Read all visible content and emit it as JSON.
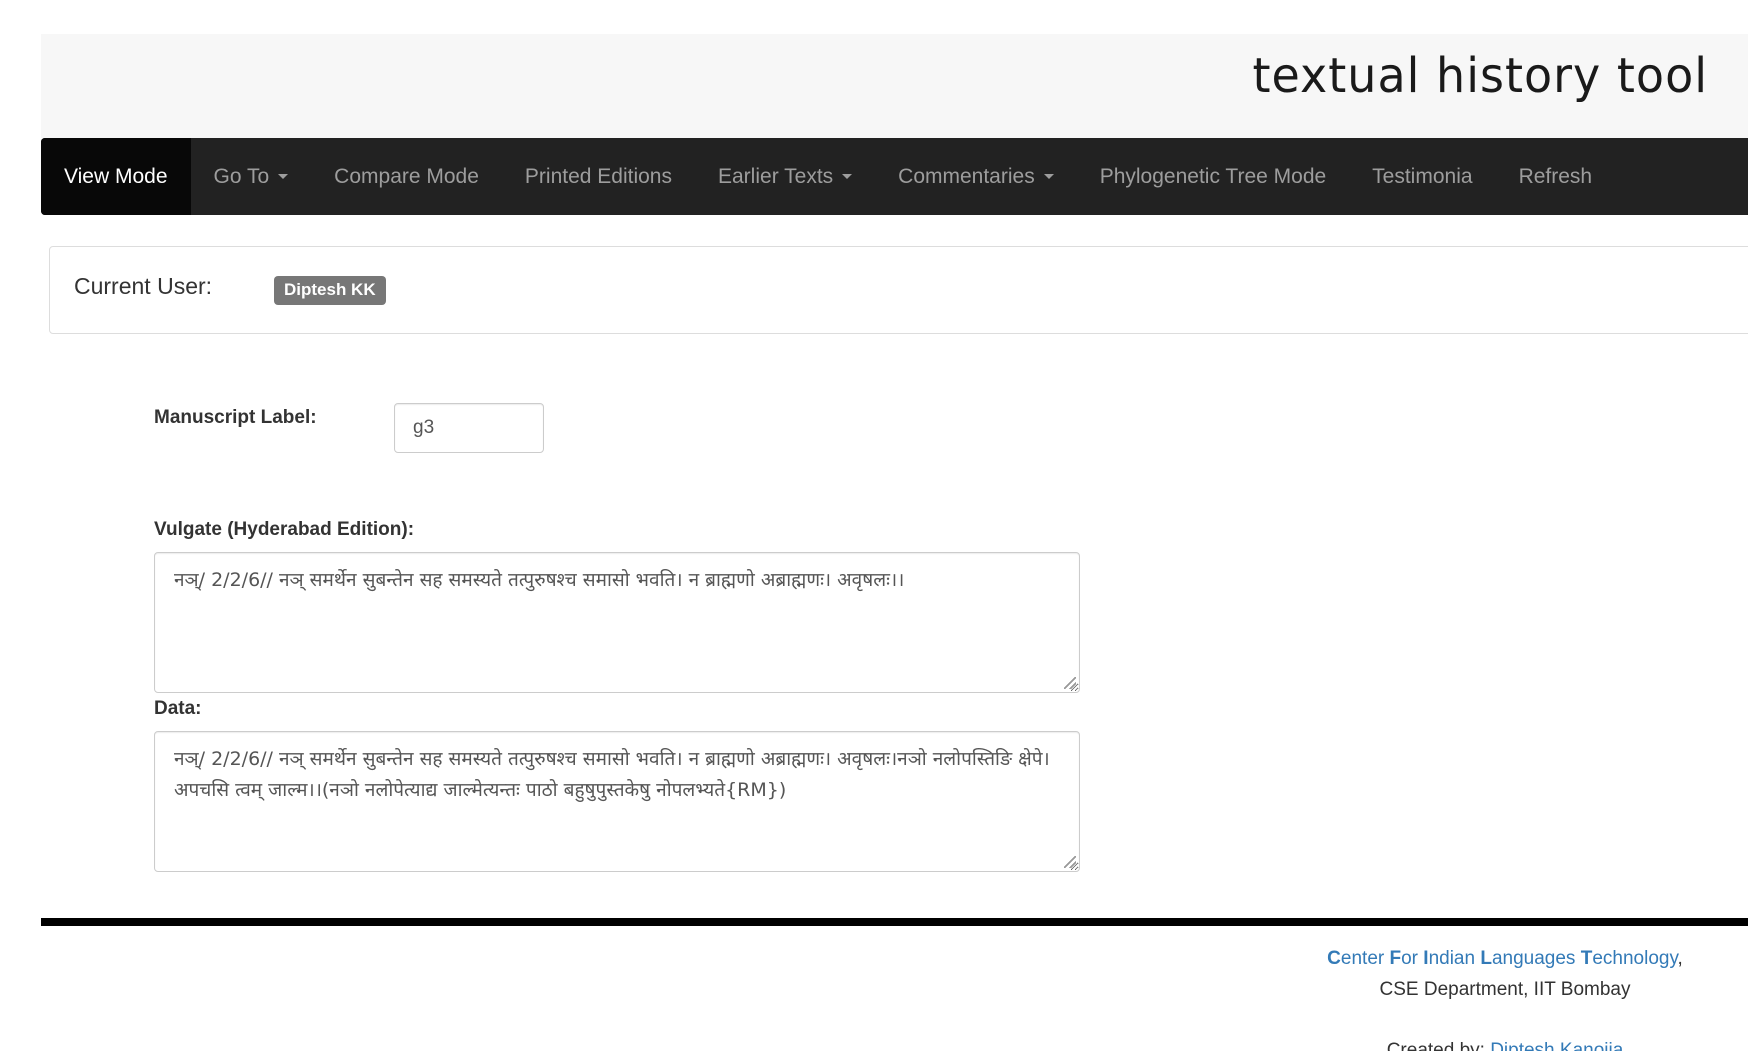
{
  "header": {
    "title": "textual history tool"
  },
  "navbar": {
    "items": [
      {
        "label": "View Mode",
        "active": true,
        "dropdown": false
      },
      {
        "label": "Go To",
        "active": false,
        "dropdown": true
      },
      {
        "label": "Compare Mode",
        "active": false,
        "dropdown": false
      },
      {
        "label": "Printed Editions",
        "active": false,
        "dropdown": false
      },
      {
        "label": "Earlier Texts",
        "active": false,
        "dropdown": true
      },
      {
        "label": "Commentaries",
        "active": false,
        "dropdown": true
      },
      {
        "label": "Phylogenetic Tree Mode",
        "active": false,
        "dropdown": false
      },
      {
        "label": "Testimonia",
        "active": false,
        "dropdown": false
      },
      {
        "label": "Refresh",
        "active": false,
        "dropdown": false
      }
    ]
  },
  "user_panel": {
    "label": "Current User:",
    "user": "Diptesh KK"
  },
  "form": {
    "manuscript_label": "Manuscript Label:",
    "manuscript_value": "g3",
    "vulgate_label": "Vulgate (Hyderabad Edition):",
    "vulgate_text": "नञ्/ 2/2/6// नञ् समर्थेन सुबन्तेन सह समस्यते तत्पुरुषश्च समासो भवति। न ब्राह्मणो अब्राह्मणः। अवृषलः।।",
    "data_label": "Data:",
    "data_text": "नञ्/ 2/2/6// नञ् समर्थेन सुबन्तेन सह समस्यते तत्पुरुषश्च समासो भवति। न ब्राह्मणो अब्राह्मणः। अवृषलः।नञो नलोपस्तिङि क्षेपे। अपचसि त्वम् जाल्म।।(नञो नलोपेत्याद्य जाल्मेत्यन्तः पाठो बहुषुपुस्तकेषु नोपलभ्यते{RM})"
  },
  "footer": {
    "org_parts": [
      {
        "initial": "C",
        "rest": "enter "
      },
      {
        "initial": "F",
        "rest": "or "
      },
      {
        "initial": "I",
        "rest": "ndian "
      },
      {
        "initial": "L",
        "rest": "anguages "
      },
      {
        "initial": "T",
        "rest": "echnology"
      }
    ],
    "org_suffix": ",",
    "department": "CSE Department, IIT Bombay",
    "created_by_label": "Created by: ",
    "created_by_name": "Diptesh Kanojia"
  },
  "colors": {
    "navbar_bg": "#222222",
    "navbar_active_bg": "#080808",
    "navbar_text": "#9d9d9d",
    "badge_bg": "#777777",
    "link": "#337ab7",
    "header_bg": "#f7f7f7"
  }
}
